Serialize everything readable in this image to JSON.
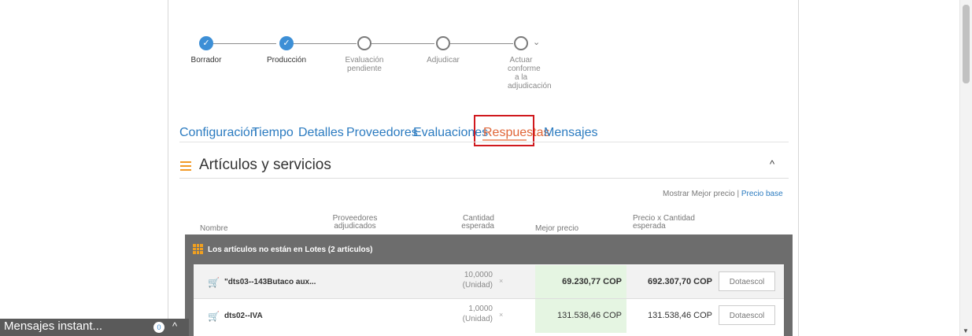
{
  "progress": {
    "steps": [
      {
        "label": "Borrador",
        "state": "done"
      },
      {
        "label": "Producción",
        "state": "done"
      },
      {
        "label": "Evaluación pendiente",
        "state": "pending"
      },
      {
        "label": "Adjudicar",
        "state": "pending"
      },
      {
        "label": "Actuar conforme a la adjudicación",
        "state": "pending"
      }
    ],
    "more_icon": "chevron-down-icon",
    "check_glyph": "✓"
  },
  "tabs": [
    {
      "label": "Configuración"
    },
    {
      "label": "Tiempo"
    },
    {
      "label": "Detalles"
    },
    {
      "label": "Proveedores"
    },
    {
      "label": "Evaluaciones"
    },
    {
      "label": "Respuestas",
      "active": true
    },
    {
      "label": "Mensajes"
    }
  ],
  "section": {
    "title": "Artículos y servicios",
    "icon": "list-icon",
    "toggle": "^"
  },
  "price_toggle": {
    "label": "Mostrar Mejor precio",
    "separator": "|",
    "link": "Precio base"
  },
  "table": {
    "headers": {
      "name": "Nombre",
      "suppliers": "Proveedores adjudicados",
      "quantity": "Cantidad esperada",
      "best_price": "Mejor precio",
      "price_x_qty": "Precio x Cantidad esperada"
    },
    "group": {
      "label": "Los artículos no están en Lotes (2 artículos)"
    },
    "rows": [
      {
        "name": "\"dts03--143Butaco aux...",
        "quantity": "10,0000",
        "unit": "(Unidad)",
        "times": "×",
        "best_price": "69.230,77 COP",
        "total": "692.307,70 COP",
        "supplier": "Dotaescol"
      },
      {
        "name": "dts02--IVA",
        "quantity": "1,0000",
        "unit": "(Unidad)",
        "times": "×",
        "best_price": "131.538,46 COP",
        "total": "131.538,46 COP",
        "supplier": "Dotaescol"
      }
    ]
  },
  "chat": {
    "label": "Mensajes instant...",
    "count": "0",
    "toggle": "^"
  },
  "colors": {
    "accent_blue": "#3d8fd6",
    "active_tab": "#e06638",
    "highlight_box": "#d0191e",
    "group_bar": "#6d6d6d",
    "best_price_bg": "#e5f5e2"
  }
}
